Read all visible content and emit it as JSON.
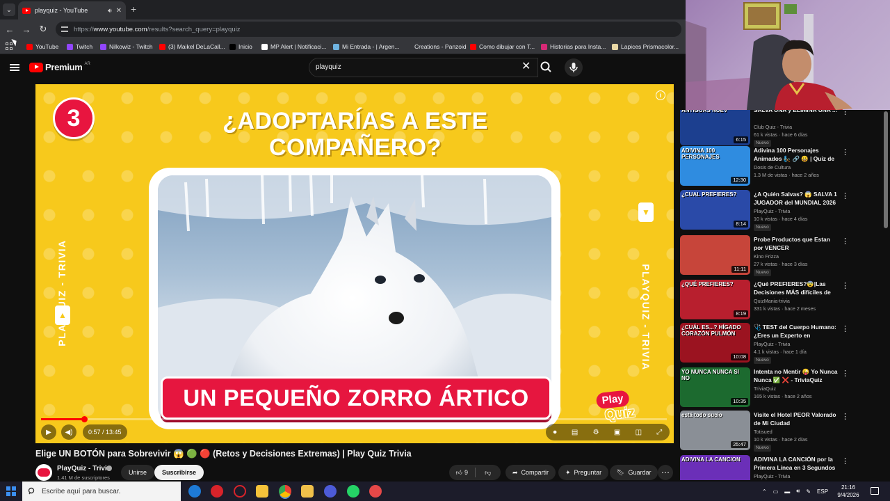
{
  "browser": {
    "tab_title": "playquiz - YouTube",
    "url_prefix": "https://",
    "url_domain": "www.youtube.com",
    "url_path": "/results?search_query=playquiz",
    "bookmarks": [
      {
        "label": "YouTube",
        "color": "#ff0000"
      },
      {
        "label": "Twitch",
        "color": "#9146ff"
      },
      {
        "label": "Nilkowiz - Twitch",
        "color": "#9146ff"
      },
      {
        "label": "(3) Maikel DeLaCall...",
        "color": "#ff0000"
      },
      {
        "label": "Inicio",
        "color": "#000000"
      },
      {
        "label": "MP Alert | Notificaci...",
        "color": "#ffffff"
      },
      {
        "label": "Mi Entrada - | Argen...",
        "color": "#6fb3e0"
      },
      {
        "label": "Creations - Panzoid",
        "color": "#35363a"
      },
      {
        "label": "Como dibujar con T...",
        "color": "#ff0000"
      },
      {
        "label": "Historias para Insta...",
        "color": "#d62976"
      },
      {
        "label": "Lapices Prismacolor...",
        "color": "#e8d7a5"
      }
    ]
  },
  "header": {
    "logo_text": "Premium",
    "country_code": "AR",
    "search_value": "playquiz"
  },
  "player": {
    "step_number": "3",
    "question": "¿ADOPTARÍAS A ESTE COMPAÑERO?",
    "answer": "UN PEQUEÑO ZORRO ÁRTICO",
    "side_left": "PLAYQUIZ - TRIVIA",
    "side_right": "PLAYQUIZ - TRIVIA",
    "brand_play": "Play",
    "brand_quiz": "Quiz",
    "time_display": "0:57 / 13:45",
    "progress_fraction": 0.069
  },
  "video": {
    "title": "Elige UN BOTÓN para Sobrevivir 😱 🟢 🔴 (Retos y Decisiones Extremas) | Play Quiz Trivia",
    "channel_name": "PlayQuiz - Trivia",
    "subscribers": "1.41 M de suscriptores",
    "join_label": "Unirse",
    "subscribe_label": "Suscribirse",
    "like_count": "9",
    "share_label": "Compartir",
    "ask_label": "Preguntar",
    "save_label": "Guardar"
  },
  "recommendations": [
    {
      "title": "SALVA UNA y ELIMINA UNA ...",
      "channel": "Club Quiz - Trivia",
      "meta": "61 k vistas · hace 6 días",
      "duration": "6:15",
      "new": "Nuevo",
      "caption": "ANTIGUAS  NUEV",
      "bg": "#1c3f8f"
    },
    {
      "title": "Adivina 100 Personajes Animados 🧞 🔗 😀 | Quiz de ...",
      "channel": "Dosis de Cultura",
      "meta": "1.3 M de vistas · hace 2 años",
      "duration": "12:30",
      "new": "",
      "caption": "ADIVINA 100 PERSONAJES",
      "bg": "#2f8ce0"
    },
    {
      "title": "¿A Quién Salvas? 😱 SALVA 1 JUGADOR del MUNDIAL 2026 ...",
      "channel": "PlayQuiz - Trivia",
      "meta": "10 k vistas · hace 4 días",
      "duration": "8:14",
      "new": "Nuevo",
      "caption": "¿CUAL PREFIERES?",
      "bg": "#2a4aa8"
    },
    {
      "title": "Probe Productos que Estan por VENCER",
      "channel": "Kino Frizza",
      "meta": "27 k vistas · hace 3 días",
      "duration": "11:11",
      "new": "Nuevo",
      "caption": "",
      "bg": "#c7453a"
    },
    {
      "title": "¿Qué PREFIERES?😨|Las Decisiones MÁS difíciles de T...",
      "channel": "QuizMania-trivia",
      "meta": "331 k vistas · hace 2 meses",
      "duration": "8:19",
      "new": "",
      "caption": "¿QUÉ PREFIERES?",
      "bg": "#b81f2e"
    },
    {
      "title": "🩺 TEST del Cuerpo Humano: ¿Eres un Experto en Anatomía...",
      "channel": "PlayQuiz - Trivia",
      "meta": "4.1 k vistas · hace 1 día",
      "duration": "10:08",
      "new": "Nuevo",
      "caption": "¿CUÁL ES...? HÍGADO CORAZÓN PULMÓN",
      "bg": "#9b1320"
    },
    {
      "title": "Intenta no Mentir 😜 Yo Nunca Nunca ✅ ❌ - TriviaQuiz Part...",
      "channel": "TriviaQuiz",
      "meta": "165 k vistas · hace 2 años",
      "duration": "10:35",
      "new": "",
      "caption": "YO NUNCA NUNCA  SI  NO",
      "bg": "#1c6a2f"
    },
    {
      "title": "Visite el Hotel PEOR Valorado de Mi Ciudad",
      "channel": "Totisued",
      "meta": "10 k vistas · hace 2 días",
      "duration": "25:47",
      "new": "Nuevo",
      "caption": "está todo sucio",
      "bg": "#8a8f96"
    },
    {
      "title": "ADIVINA LA CANCIÓN por la Primera Línea en 3 Segundos ...",
      "channel": "PlayQuiz - Trivia",
      "meta": "",
      "duration": "",
      "new": "",
      "caption": "ADIVINA LA CANCION",
      "bg": "#6b2fb8"
    }
  ],
  "taskbar": {
    "search_placeholder": "Escribe aquí para buscar.",
    "language": "ESP",
    "time": "21:16",
    "date": "9/4/2026"
  }
}
